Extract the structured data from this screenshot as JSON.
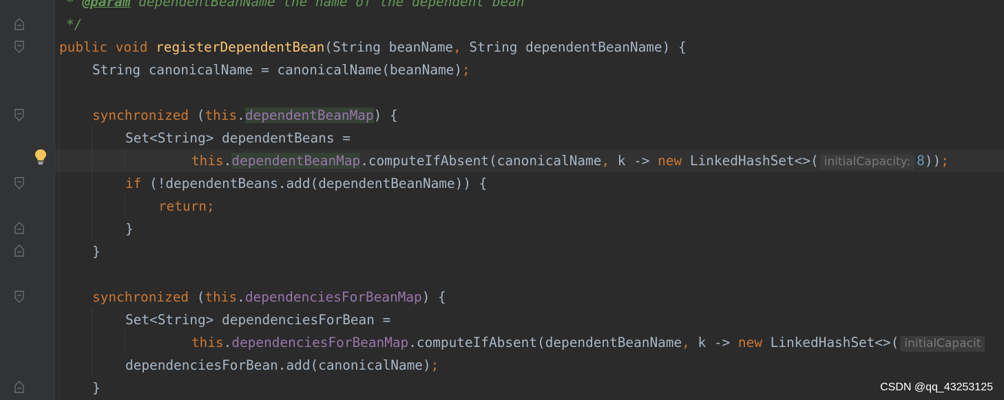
{
  "editor": {
    "language": "java",
    "colors": {
      "background": "#2b2b2b",
      "gutter": "#313335",
      "keyword": "#cc7832",
      "method": "#ffc66d",
      "field": "#9876aa",
      "number": "#6897bb",
      "comment": "#629755",
      "text": "#a9b7c6"
    },
    "gutter_icons": [
      "fold-marker-icon",
      "lightbulb-icon"
    ],
    "lines": {
      "l1": {
        "c1": "* ",
        "c2": "@param",
        "c3": " dependentBeanName the name of the dependent bean"
      },
      "l2": {
        "c1": "*/"
      },
      "l3": {
        "kw": "public void ",
        "fn": "registerDependentBean",
        "t1": "(String beanName",
        "comma": ",",
        "t2": " String dependentBeanName) {"
      },
      "l4": {
        "t": "String canonicalName = canonicalName(beanName)",
        "semi": ";"
      },
      "l5": {
        "kw": "synchronized",
        "t1": " (",
        "this": "this",
        "dot": ".",
        "fld": "dependentBeanMap",
        "t2": ") {"
      },
      "l6": {
        "t": "Set<String> dependentBeans ="
      },
      "l7": {
        "this": "this",
        "dot": ".",
        "fld": "dependentBeanMap",
        "t1": ".computeIfAbsent(canonicalName",
        "comma": ",",
        "t2": " k -> ",
        "new": "new",
        "t3": " LinkedHashSet<>(",
        "hint": "initialCapacity:",
        "num": "8",
        "t4": "))",
        "semi": ";"
      },
      "l8": {
        "kw": "if",
        "t": " (!dependentBeans.add(dependentBeanName)) {"
      },
      "l9": {
        "kw": "return",
        "semi": ";"
      },
      "l10": {
        "t": "}"
      },
      "l11": {
        "t": "}"
      },
      "l12": {
        "kw": "synchronized",
        "t1": " (",
        "this": "this",
        "dot": ".",
        "fld": "dependenciesForBeanMap",
        "t2": ") {"
      },
      "l13": {
        "t": "Set<String> dependenciesForBean ="
      },
      "l14": {
        "this": "this",
        "dot": ".",
        "fld": "dependenciesForBeanMap",
        "t1": ".computeIfAbsent(dependentBeanName",
        "comma": ",",
        "t2": " k -> ",
        "new": "new",
        "t3": " LinkedHashSet<>(",
        "hint": "initialCapacit"
      },
      "l15": {
        "t": "dependenciesForBean.add(canonicalName)",
        "semi": ";"
      },
      "l16": {
        "t": "}"
      }
    }
  },
  "watermark": {
    "text": "CSDN @qq_43253125"
  }
}
